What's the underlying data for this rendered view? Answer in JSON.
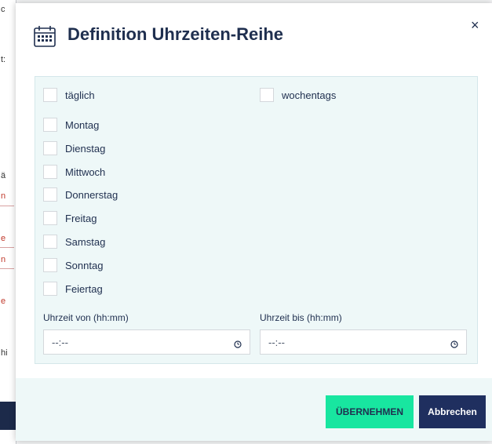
{
  "modal": {
    "title": "Definition Uhrzeiten-Reihe",
    "close_label": "×"
  },
  "options": {
    "daily": "täglich",
    "weekdays": "wochentags"
  },
  "days": [
    "Montag",
    "Dienstag",
    "Mittwoch",
    "Donnerstag",
    "Freitag",
    "Samstag",
    "Sonntag",
    "Feiertag"
  ],
  "time_from": {
    "label": "Uhrzeit von (hh:mm)",
    "value": "--:--"
  },
  "time_to": {
    "label": "Uhrzeit bis (hh:mm)",
    "value": "--:--"
  },
  "footer": {
    "confirm_label": "ÜBERNEHMEN",
    "cancel_label": "Abbrechen"
  },
  "colors": {
    "primary_button": "#18e6a0",
    "secondary_button": "#1f2f5f",
    "panel_bg": "#eef8f8"
  }
}
